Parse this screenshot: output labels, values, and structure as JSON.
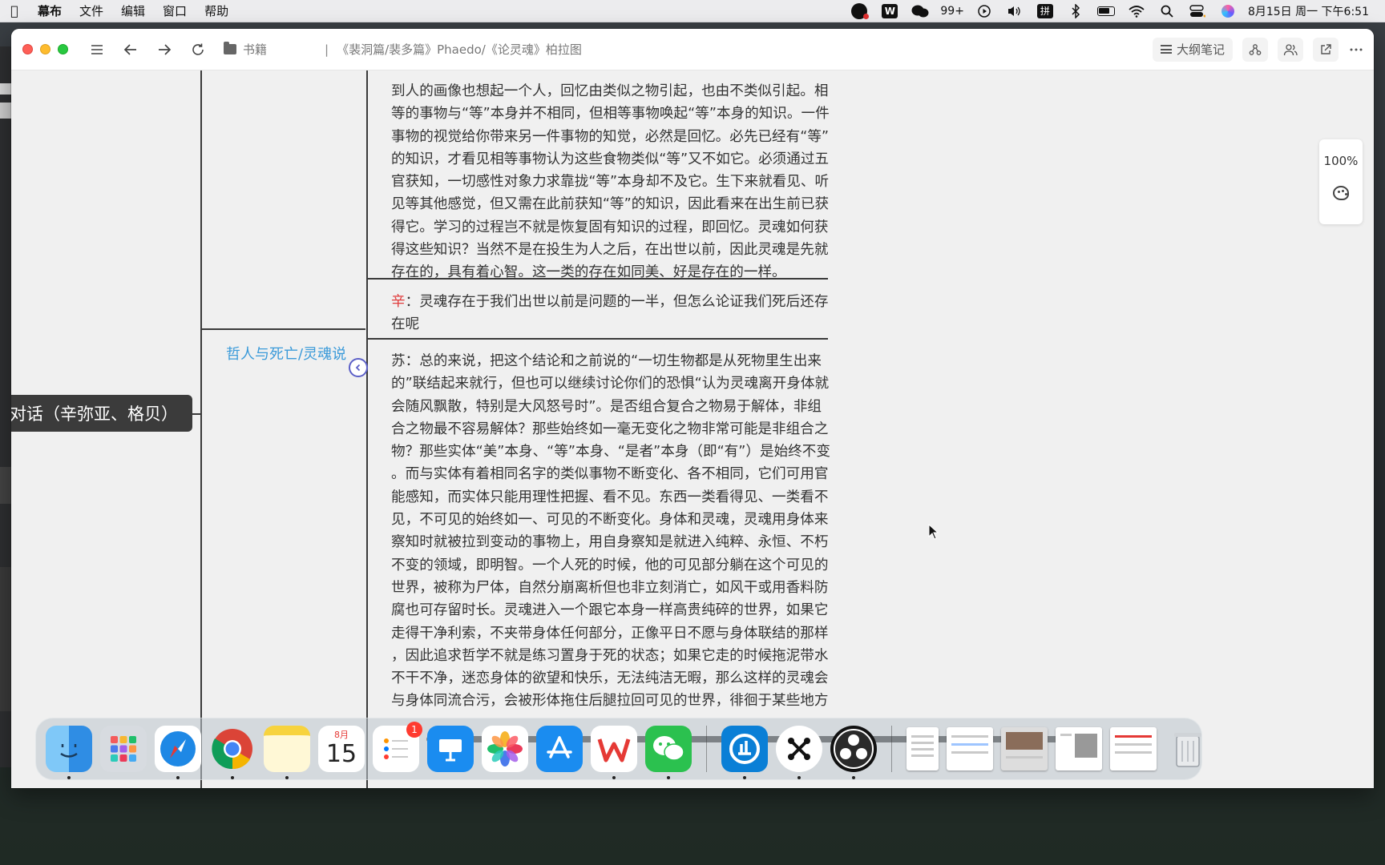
{
  "menubar": {
    "app_name": "幕布",
    "menus": [
      "文件",
      "编辑",
      "窗口",
      "帮助"
    ],
    "wechat_count": "99+",
    "datetime": "8月15日 周一 下午6:51"
  },
  "toolbar": {
    "breadcrumb_root": "书籍",
    "breadcrumb_separator": "|",
    "document_title": "《裴洞篇/裴多篇》Phaedo/《论灵魂》柏拉图",
    "outline_button": "大纲笔记"
  },
  "mindmap": {
    "root_label": "对话（辛弥亚、格贝）",
    "branch_label": "哲人与死亡/灵魂说",
    "block1_lines": [
      "到人的画像也想起一个人，回忆由类似之物引起，也由不类似引起。相",
      "等的事物与“等”本身并不相同，但相等事物唤起“等”本身的知识。一件",
      "事物的视觉给你带来另一件事物的知觉，必然是回忆。必先已经有“等”",
      "的知识，才看见相等事物认为这些食物类似“等”又不如它。必须通过五",
      "官获知，一切感性对象力求靠拢“等”本身却不及它。生下来就看见、听",
      "见等其他感觉，但又需在此前获知“等”的知识，因此看来在出生前已获",
      "得它。学习的过程岂不就是恢复固有知识的过程，即回忆。灵魂如何获",
      "得这些知识？当然不是在投生为人之后，在出世以前，因此灵魂是先就",
      "存在的，具有着心智。这一类的存在如同美、好是存在的一样。"
    ],
    "block2_speaker": "辛",
    "block2_lines": [
      "：灵魂存在于我们出世以前是问题的一半，但怎么论证我们死后还存",
      "在呢"
    ],
    "block3_lines": [
      "苏：总的来说，把这个结论和之前说的“一切生物都是从死物里生出来",
      "的”联结起来就行，但也可以继续讨论你们的恐惧“认为灵魂离开身体就",
      "会随风飘散，特别是大风怒号时”。是否组合复合之物易于解体，非组",
      "合之物最不容易解体？那些始终如一毫无变化之物非常可能是非组合之",
      "物？那些实体“美”本身、“等”本身、“是者”本身（即“有”）是始终不变",
      "。而与实体有着相同名字的类似事物不断变化、各不相同，它们可用官",
      "能感知，而实体只能用理性把握、看不见。东西一类看得见、一类看不",
      "见，不可见的始终如一、可见的不断变化。身体和灵魂，灵魂用身体来",
      "察知时就被拉到变动的事物上，用自身察知是就进入纯粹、永恒、不朽",
      "不变的领域，即明智。一个人死的时候，他的可见部分躺在这个可见的",
      "世界，被称为尸体，自然分崩离析但也非立刻消亡，如风干或用香料防",
      "腐也可存留时长。灵魂进入一个跟它本身一样高贵纯碎的世界，如果它",
      "走得干净利索，不夹带身体任何部分，正像平日不愿与身体联结的那样",
      "，因此追求哲学不就是练习置身于死的状态；如果它走的时候拖泥带水",
      "不干不净，迷恋身体的欲望和快乐，无法纯洁无暇，那么这样的灵魂会",
      "与身体同流合污，会被形体拖住后腿拉回可见的世界，徘徊于某些地方"
    ]
  },
  "zoom": {
    "level": "100%"
  },
  "dock": {
    "apps": [
      "Finder",
      "Launchpad",
      "Safari",
      "Chrome",
      "Notes",
      "Calendar",
      "Reminders",
      "Keynote",
      "Photos",
      "App Store",
      "WPS Office",
      "WeChat",
      "CleanMyMac",
      "Scrivener",
      "OBS Studio"
    ],
    "calendar_month": "8月",
    "calendar_day": "15",
    "reminders_badge": "1",
    "trash_label": "Trash"
  },
  "colors": {
    "accent_blue": "#3a9ad9",
    "speaker_red": "#e03b3b",
    "node_dark": "#3b3b3b",
    "collapse_purple": "#5b5fc7"
  }
}
